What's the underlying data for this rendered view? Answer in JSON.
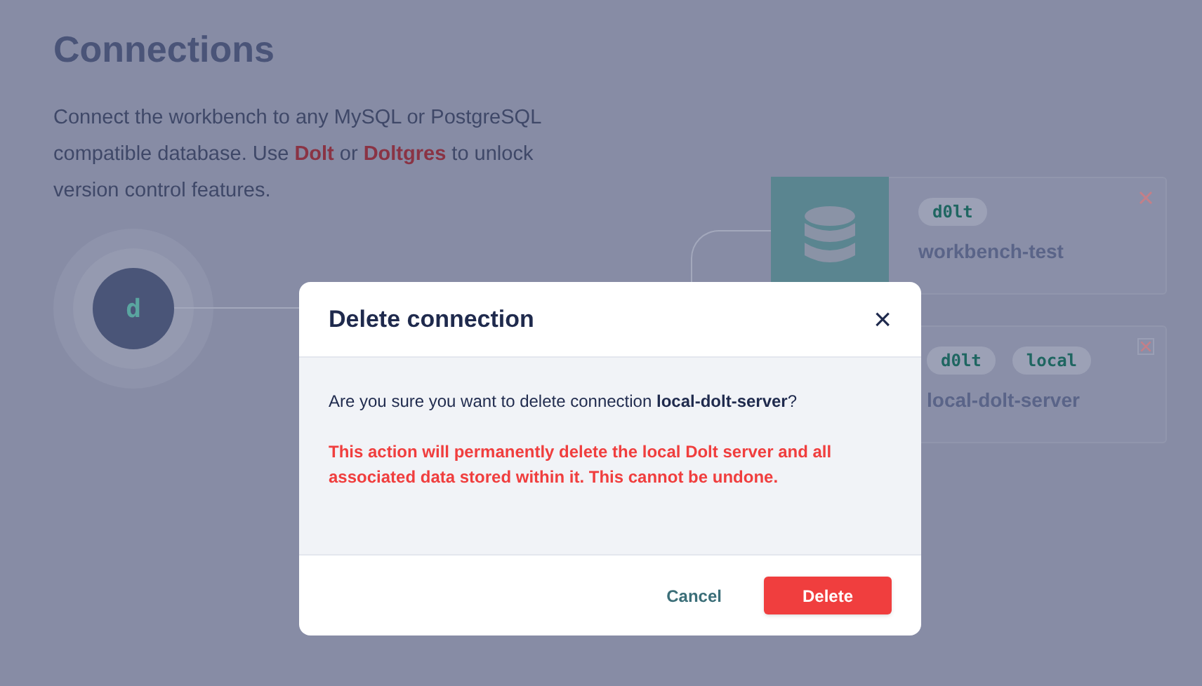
{
  "page": {
    "title": "Connections",
    "description": "Connect the workbench to any MySQL or PostgreSQL compatible database. Use **Dolt** or **Doltgres** to unlock version control features."
  },
  "hub": {
    "letter": "d"
  },
  "connections": [
    {
      "tags": [
        "d0lt"
      ],
      "name": "workbench-test",
      "show_tile": true
    },
    {
      "tags": [
        "d0lt",
        "local"
      ],
      "name": "local-dolt-server",
      "show_tile": false
    }
  ],
  "dialog": {
    "title": "Delete connection",
    "close": "×",
    "question": "Are you sure you want to delete connection **local-dolt-server**?",
    "warning": "This action will permanently delete the local Dolt server and all associated data stored within it. This cannot be undone.",
    "buttons": [
      {
        "label": "Cancel",
        "kind": "secondary"
      },
      {
        "label": "Delete",
        "kind": "danger"
      }
    ]
  }
}
